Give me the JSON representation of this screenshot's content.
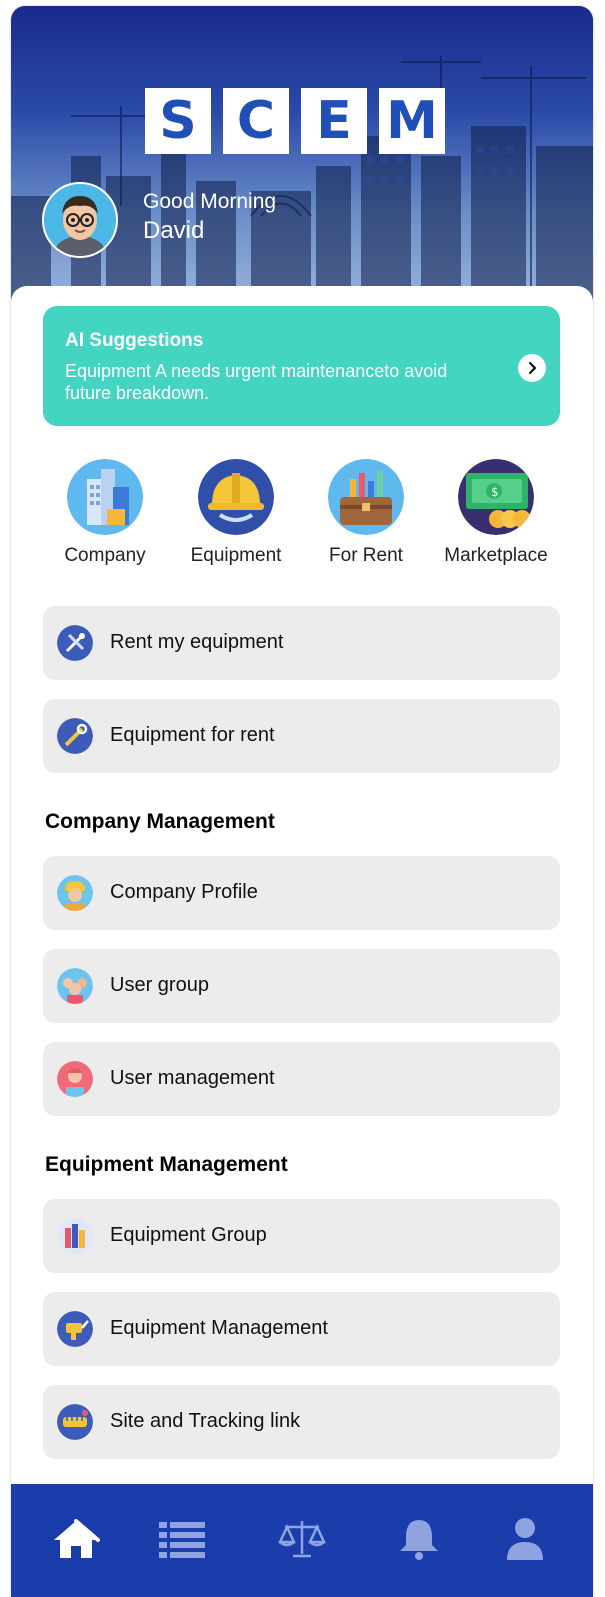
{
  "header": {
    "logo_letters": [
      "S",
      "C",
      "E",
      "M"
    ],
    "greeting": "Good Morning",
    "user_name": "David"
  },
  "ai_card": {
    "title": "AI Suggestions",
    "message": "Equipment A needs urgent maintenanceto avoid future breakdown.",
    "arrow_icon": "chevron-right-icon"
  },
  "quick_actions": [
    {
      "label": "Company",
      "icon": "building-icon"
    },
    {
      "label": "Equipment",
      "icon": "hard-hat-icon"
    },
    {
      "label": "For Rent",
      "icon": "briefcase-chart-icon"
    },
    {
      "label": "Marketplace",
      "icon": "money-coins-icon"
    }
  ],
  "rent_items": [
    {
      "label": "Rent my equipment",
      "icon": "tools-icon"
    },
    {
      "label": "Equipment for rent",
      "icon": "wrench-icon"
    }
  ],
  "company_section": {
    "title": "Company Management",
    "items": [
      {
        "label": "Company Profile",
        "icon": "worker-icon"
      },
      {
        "label": "User group",
        "icon": "user-group-icon"
      },
      {
        "label": "User management",
        "icon": "user-management-icon"
      }
    ]
  },
  "equipment_section": {
    "title": "Equipment Management",
    "items": [
      {
        "label": "Equipment Group",
        "icon": "equipment-group-icon"
      },
      {
        "label": "Equipment Management",
        "icon": "drill-icon"
      },
      {
        "label": "Site and Tracking link",
        "icon": "tape-measure-icon"
      }
    ]
  },
  "bottom_nav": [
    {
      "name": "home",
      "icon": "home-icon",
      "active": true
    },
    {
      "name": "list",
      "icon": "list-icon",
      "active": false
    },
    {
      "name": "legal",
      "icon": "scale-icon",
      "active": false
    },
    {
      "name": "notifications",
      "icon": "bell-icon",
      "active": false
    },
    {
      "name": "profile",
      "icon": "user-icon",
      "active": false
    }
  ],
  "colors": {
    "brand_blue": "#1b3dab",
    "ai_card": "#43d4c2",
    "row_bg": "#ececec",
    "logo_text": "#1f4fb7"
  }
}
